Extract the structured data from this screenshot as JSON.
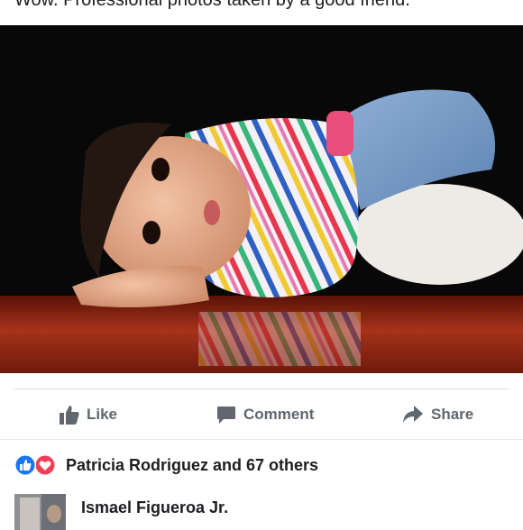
{
  "post": {
    "caption": "Wow. Professional photos taken by a good friend."
  },
  "actions": {
    "like_label": "Like",
    "comment_label": "Comment",
    "share_label": "Share"
  },
  "reactions": {
    "icons": [
      "like-icon",
      "love-icon"
    ],
    "summary": "Patricia Rodriguez and 67 others"
  },
  "comment": {
    "author": "Ismael Figueroa Jr."
  },
  "colors": {
    "action_text": "#606770",
    "like_blue": "#1877f2",
    "love_red": "#f33e58",
    "divider": "#dadde1"
  }
}
